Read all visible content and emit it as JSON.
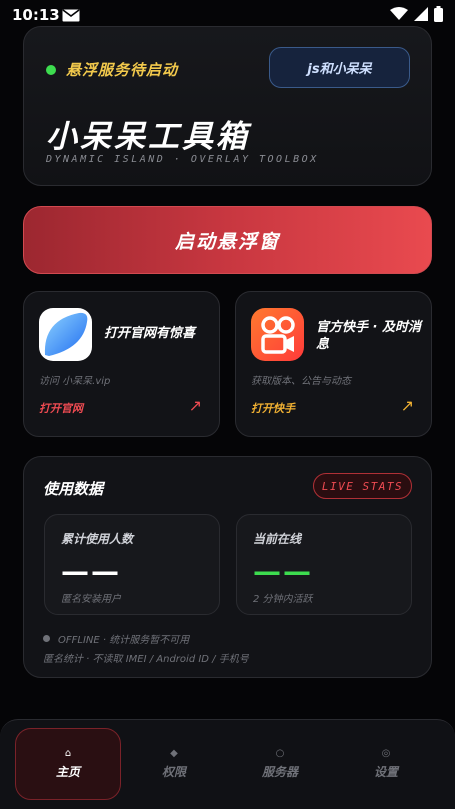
{
  "status_bar": {
    "time": "10:13",
    "icons": [
      "mail-icon",
      "wifi-icon",
      "signal-icon",
      "battery-icon"
    ]
  },
  "hero": {
    "status_text": "悬浮服务待启动",
    "js_button": "js和小呆呆",
    "title": "小呆呆工具箱",
    "subtitle": "DYNAMIC ISLAND · OVERLAY TOOLBOX"
  },
  "launch_button": "启动悬浮窗",
  "links": {
    "website": {
      "title": "打开官网有惊喜",
      "desc": "访问 小呆呆.vip",
      "action": "打开官网",
      "arrow": "↗"
    },
    "kuaishou": {
      "title": "官方快手 · 及时消息",
      "desc": "获取版本、公告与动态",
      "action": "打开快手",
      "arrow": "↗"
    }
  },
  "stats": {
    "title": "使用数据",
    "badge": "LIVE STATS",
    "total": {
      "label": "累计使用人数",
      "value": "——",
      "hint": "匿名安装用户"
    },
    "online": {
      "label": "当前在线",
      "value": "——",
      "hint": "2 分钟内活跃"
    },
    "footer_status": "OFFLINE · 统计服务暂不可用",
    "footer_note": "匿名统计 · 不读取 IMEI / Android ID / 手机号"
  },
  "nav": [
    {
      "label": "主页",
      "icon": "home-icon",
      "glyph": "⌂",
      "active": true
    },
    {
      "label": "权限",
      "icon": "diamond-icon",
      "glyph": "◆",
      "active": false
    },
    {
      "label": "服务器",
      "icon": "server-icon",
      "glyph": "○",
      "active": false
    },
    {
      "label": "设置",
      "icon": "settings-icon",
      "glyph": "◎",
      "active": false
    }
  ],
  "colors": {
    "accent_red": "#e94a4f",
    "status_green": "#3ddc4f",
    "status_gold": "#f2c94c"
  }
}
